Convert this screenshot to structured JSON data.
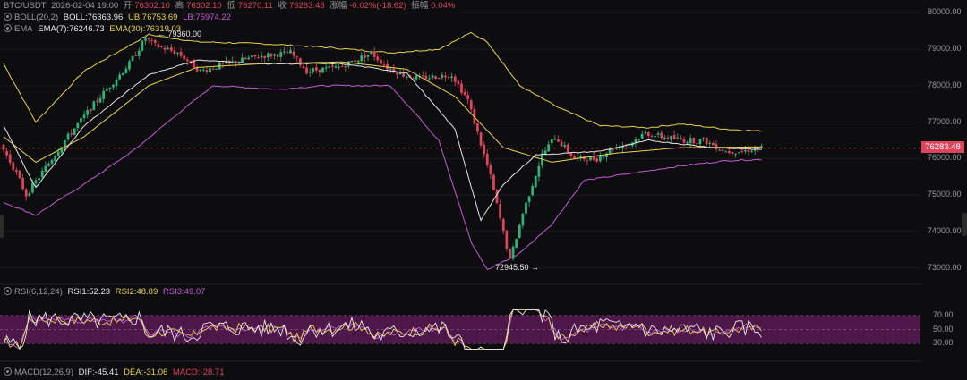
{
  "header": {
    "pair": "BTC/USDT",
    "datetime": "2026-02-04 19:00",
    "open_label": "开",
    "open": "76302.10",
    "high_label": "高",
    "high": "76302.10",
    "low_label": "低",
    "low": "76270.11",
    "close_label": "收",
    "close": "76283.48",
    "change_label": "涨幅",
    "change": "-0.02%(-18.62)",
    "amp_label": "振幅",
    "amp": "0.04%"
  },
  "boll": {
    "name": "BOLL(20,2)",
    "mid": "BOLL:76363.96",
    "ub": "UB:76753.69",
    "lb": "LB:75974.22"
  },
  "ema": {
    "name": "EMA",
    "ema7": "EMA(7):76246.73",
    "ema30": "EMA(30):76319.03"
  },
  "rsi": {
    "name": "RSI(6,12,24)",
    "rsi1": "RSI1:52.23",
    "rsi2": "RSI2:48.89",
    "rsi3": "RSI3:49.07"
  },
  "macd": {
    "name": "MACD(12,26,9)",
    "dif": "DIF:-45.41",
    "dea": "DEA:-31.06",
    "macd": "MACD:-28.71"
  },
  "price_tag": "76283.48",
  "annotations": {
    "high_marker": "← 79360.00",
    "low_marker": "72945.50 →"
  },
  "colors": {
    "up": "#2fb27a",
    "down": "#e0435b",
    "boll_band": "#e7d24f",
    "boll_lb": "#c25ad6",
    "ema7": "#e6e6e6",
    "ema30": "#e7d24f",
    "rsi_band": "#5a1a55"
  },
  "chart_data": [
    {
      "type": "candlestick",
      "title": "BTC/USDT",
      "yticks": [
        80000,
        79000,
        78000,
        77000,
        76000,
        75000,
        74000,
        73000
      ],
      "ytick_labels": [
        "80000.00",
        "79000.00",
        "78000.00",
        "77000.00",
        "76000.00",
        "75000.00",
        "74000.00",
        "73000.00"
      ],
      "ylim": [
        72600,
        80250
      ],
      "last_price": 76283.48,
      "high_marker": 79360.0,
      "low_marker": 72945.5,
      "series_ema7_anchor": [
        [
          0,
          76900
        ],
        [
          10,
          75200
        ],
        [
          25,
          76900
        ],
        [
          45,
          78300
        ],
        [
          60,
          78700
        ],
        [
          80,
          78600
        ],
        [
          105,
          78600
        ],
        [
          125,
          78350
        ],
        [
          140,
          76800
        ],
        [
          148,
          74300
        ],
        [
          155,
          75300
        ],
        [
          165,
          76100
        ],
        [
          185,
          76200
        ],
        [
          200,
          76500
        ],
        [
          220,
          76300
        ],
        [
          235,
          76247
        ]
      ],
      "series_ema30_anchor": [
        [
          0,
          76600
        ],
        [
          10,
          75900
        ],
        [
          25,
          76600
        ],
        [
          45,
          78000
        ],
        [
          60,
          78500
        ],
        [
          80,
          78600
        ],
        [
          105,
          78650
        ],
        [
          125,
          78450
        ],
        [
          140,
          77700
        ],
        [
          155,
          76300
        ],
        [
          170,
          75900
        ],
        [
          190,
          76150
        ],
        [
          210,
          76300
        ],
        [
          235,
          76319
        ]
      ],
      "series_ub_anchor": [
        [
          0,
          78600
        ],
        [
          10,
          77000
        ],
        [
          25,
          78400
        ],
        [
          45,
          79400
        ],
        [
          60,
          79200
        ],
        [
          80,
          79150
        ],
        [
          100,
          79050
        ],
        [
          120,
          78900
        ],
        [
          135,
          79000
        ],
        [
          145,
          79450
        ],
        [
          150,
          79200
        ],
        [
          160,
          78000
        ],
        [
          172,
          77400
        ],
        [
          185,
          76900
        ],
        [
          200,
          76850
        ],
        [
          210,
          76950
        ],
        [
          225,
          76800
        ],
        [
          235,
          76754
        ]
      ],
      "series_lb_anchor": [
        [
          0,
          74800
        ],
        [
          10,
          74450
        ],
        [
          25,
          75300
        ],
        [
          40,
          76200
        ],
        [
          55,
          77300
        ],
        [
          65,
          78000
        ],
        [
          85,
          77900
        ],
        [
          100,
          78000
        ],
        [
          120,
          78000
        ],
        [
          135,
          76500
        ],
        [
          145,
          73700
        ],
        [
          150,
          72950
        ],
        [
          160,
          73400
        ],
        [
          170,
          74200
        ],
        [
          180,
          75400
        ],
        [
          195,
          75600
        ],
        [
          210,
          75800
        ],
        [
          225,
          75950
        ],
        [
          235,
          75974
        ]
      ],
      "candle_path": [
        [
          0,
          76400
        ],
        [
          5,
          75600
        ],
        [
          8,
          75000
        ],
        [
          12,
          75500
        ],
        [
          20,
          76500
        ],
        [
          30,
          77600
        ],
        [
          40,
          78600
        ],
        [
          45,
          79300
        ],
        [
          48,
          79100
        ],
        [
          55,
          78900
        ],
        [
          62,
          78400
        ],
        [
          70,
          78600
        ],
        [
          80,
          78800
        ],
        [
          90,
          78900
        ],
        [
          95,
          78400
        ],
        [
          105,
          78500
        ],
        [
          115,
          78900
        ],
        [
          120,
          78500
        ],
        [
          125,
          78300
        ],
        [
          130,
          78200
        ],
        [
          140,
          78300
        ],
        [
          145,
          77600
        ],
        [
          152,
          75500
        ],
        [
          158,
          73200
        ],
        [
          162,
          74500
        ],
        [
          168,
          76100
        ],
        [
          172,
          76600
        ],
        [
          178,
          76000
        ],
        [
          185,
          76000
        ],
        [
          190,
          76300
        ],
        [
          195,
          76400
        ],
        [
          200,
          76700
        ],
        [
          205,
          76600
        ],
        [
          212,
          76500
        ],
        [
          218,
          76500
        ],
        [
          225,
          76200
        ],
        [
          230,
          76200
        ],
        [
          235,
          76283
        ]
      ]
    },
    {
      "type": "line",
      "title": "RSI(6,12,24)",
      "yticks": [
        70,
        50,
        30
      ],
      "ytick_labels": [
        "70.00",
        "50.00",
        "30.00"
      ],
      "ylim": [
        20,
        80
      ],
      "band": [
        30,
        70
      ],
      "last_values": {
        "RSI1": 52.23,
        "RSI2": 48.89,
        "RSI3": 49.07
      }
    },
    {
      "type": "bar",
      "title": "MACD(12,26,9)",
      "last_values": {
        "DIF": -45.41,
        "DEA": -31.06,
        "MACD": -28.71
      }
    }
  ]
}
